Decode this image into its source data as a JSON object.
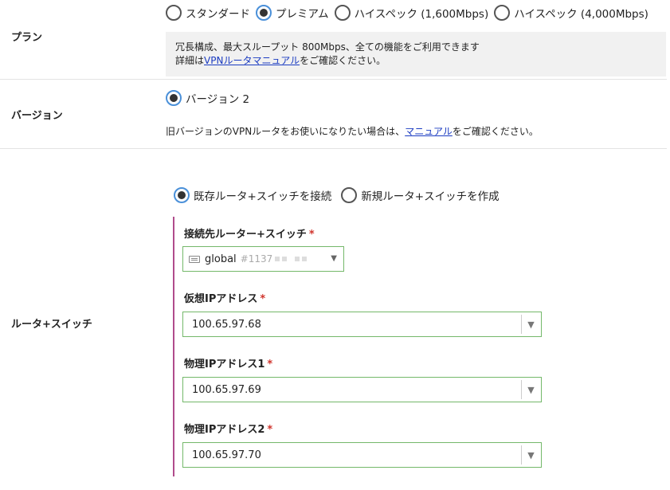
{
  "plan": {
    "label": "プラン",
    "options": [
      {
        "label": "スタンダード",
        "checked": false
      },
      {
        "label": "プレミアム",
        "checked": true
      },
      {
        "label": "ハイスペック (1,600Mbps)",
        "checked": false
      },
      {
        "label": "ハイスペック (4,000Mbps)",
        "checked": false
      }
    ],
    "description_line1": "冗長構成、最大スループット 800Mbps、全ての機能をご利用できます",
    "description_prefix": "詳細は",
    "description_link": "VPNルータマニュアル",
    "description_suffix": "をご確認ください。"
  },
  "version": {
    "label": "バージョン",
    "option": "バージョン 2",
    "note_prefix": "旧バージョンのVPNルータをお使いになりたい場合は、",
    "note_link": "マニュアル",
    "note_suffix": "をご確認ください。"
  },
  "router_switch": {
    "label": "ルータ+スイッチ",
    "options": [
      {
        "label": "既存ルータ+スイッチを接続",
        "checked": true
      },
      {
        "label": "新規ルータ+スイッチを作成",
        "checked": false
      }
    ],
    "connect_label": "接続先ルーター+スイッチ",
    "router_icon": "keyboard-icon",
    "router_name": "global",
    "router_id": "#1137",
    "virtual_ip_label": "仮想IPアドレス",
    "virtual_ip_value": "100.65.97.68",
    "physical_ip1_label": "物理IPアドレス1",
    "physical_ip1_value": "100.65.97.69",
    "physical_ip2_label": "物理IPアドレス2",
    "physical_ip2_value": "100.65.97.70"
  },
  "required_mark": "*",
  "colors": {
    "accent_border": "#74b86a",
    "link": "#1a3bc1",
    "section_bar": "#b04c8c",
    "required": "#d0342c",
    "radio_checked": "#4a90d9"
  }
}
